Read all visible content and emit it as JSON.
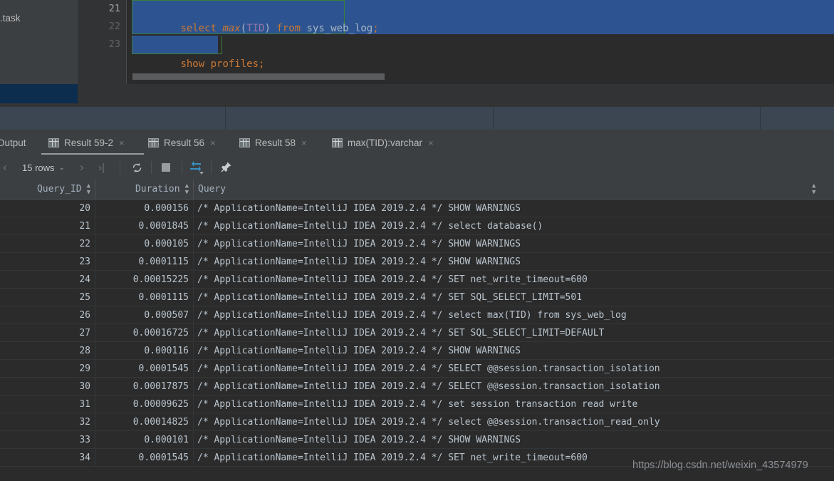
{
  "editor": {
    "left_panel_label": ".task",
    "line_numbers": [
      "21",
      "22",
      "23"
    ],
    "lines": [
      {
        "tokens": [
          {
            "t": "select ",
            "c": "kw"
          },
          {
            "t": "max",
            "c": "fn"
          },
          {
            "t": "(",
            "c": "par"
          },
          {
            "t": "TID",
            "c": "col"
          },
          {
            "t": ") ",
            "c": "par"
          },
          {
            "t": "from ",
            "c": "kw"
          },
          {
            "t": "sys_web_log",
            "c": "id"
          },
          {
            "t": ";",
            "c": "kw"
          }
        ]
      },
      {
        "tokens": []
      },
      {
        "tokens": [
          {
            "t": "show profiles;",
            "c": "kw"
          }
        ]
      }
    ],
    "selection_color": "#2d5490",
    "selection_outline_color": "#3a7d3a"
  },
  "tabs": {
    "output_label": "Output",
    "items": [
      {
        "label": "Result 59-2",
        "icon": "grid-icon",
        "close": "×",
        "active": true
      },
      {
        "label": "Result 56",
        "icon": "grid-icon",
        "close": "×",
        "active": false
      },
      {
        "label": "Result 58",
        "icon": "grid-icon",
        "close": "×",
        "active": false
      },
      {
        "label": "max(TID):varchar",
        "icon": "grid-icon",
        "close": "×",
        "active": false
      }
    ]
  },
  "toolbar": {
    "prev_page": "‹",
    "rows_label": "15 rows",
    "rows_caret": "⌄",
    "next_page": "›",
    "last_page": "›|",
    "reload": "↻",
    "stop": "stop-icon",
    "transpose": "transpose-icon",
    "pin": "✐",
    "accent_color": "#3592c4"
  },
  "grid": {
    "columns": [
      {
        "label": "Query_ID",
        "align": "right",
        "sortable": true
      },
      {
        "label": "Duration",
        "align": "right",
        "sortable": true
      },
      {
        "label": "Query",
        "align": "left",
        "sortable": true
      }
    ],
    "rows": [
      {
        "query_id": "20",
        "duration": "0.000156",
        "query": "/* ApplicationName=IntelliJ IDEA 2019.2.4 */ SHOW WARNINGS"
      },
      {
        "query_id": "21",
        "duration": "0.0001845",
        "query": "/* ApplicationName=IntelliJ IDEA 2019.2.4 */ select database()"
      },
      {
        "query_id": "22",
        "duration": "0.000105",
        "query": "/* ApplicationName=IntelliJ IDEA 2019.2.4 */ SHOW WARNINGS"
      },
      {
        "query_id": "23",
        "duration": "0.0001115",
        "query": "/* ApplicationName=IntelliJ IDEA 2019.2.4 */ SHOW WARNINGS"
      },
      {
        "query_id": "24",
        "duration": "0.00015225",
        "query": "/* ApplicationName=IntelliJ IDEA 2019.2.4 */ SET net_write_timeout=600"
      },
      {
        "query_id": "25",
        "duration": "0.0001115",
        "query": "/* ApplicationName=IntelliJ IDEA 2019.2.4 */ SET SQL_SELECT_LIMIT=501"
      },
      {
        "query_id": "26",
        "duration": "0.000507",
        "query": "/* ApplicationName=IntelliJ IDEA 2019.2.4 */ select max(TID) from sys_web_log"
      },
      {
        "query_id": "27",
        "duration": "0.00016725",
        "query": "/* ApplicationName=IntelliJ IDEA 2019.2.4 */ SET SQL_SELECT_LIMIT=DEFAULT"
      },
      {
        "query_id": "28",
        "duration": "0.000116",
        "query": "/* ApplicationName=IntelliJ IDEA 2019.2.4 */ SHOW WARNINGS"
      },
      {
        "query_id": "29",
        "duration": "0.0001545",
        "query": "/* ApplicationName=IntelliJ IDEA 2019.2.4 */ SELECT @@session.transaction_isolation"
      },
      {
        "query_id": "30",
        "duration": "0.00017875",
        "query": "/* ApplicationName=IntelliJ IDEA 2019.2.4 */ SELECT @@session.transaction_isolation"
      },
      {
        "query_id": "31",
        "duration": "0.00009625",
        "query": "/* ApplicationName=IntelliJ IDEA 2019.2.4 */ set session transaction read write"
      },
      {
        "query_id": "32",
        "duration": "0.00014825",
        "query": "/* ApplicationName=IntelliJ IDEA 2019.2.4 */ select @@session.transaction_read_only"
      },
      {
        "query_id": "33",
        "duration": "0.000101",
        "query": "/* ApplicationName=IntelliJ IDEA 2019.2.4 */ SHOW WARNINGS"
      },
      {
        "query_id": "34",
        "duration": "0.0001545",
        "query": "/* ApplicationName=IntelliJ IDEA 2019.2.4 */ SET net_write_timeout=600"
      }
    ]
  },
  "watermark": "https://blog.csdn.net/weixin_43574979"
}
